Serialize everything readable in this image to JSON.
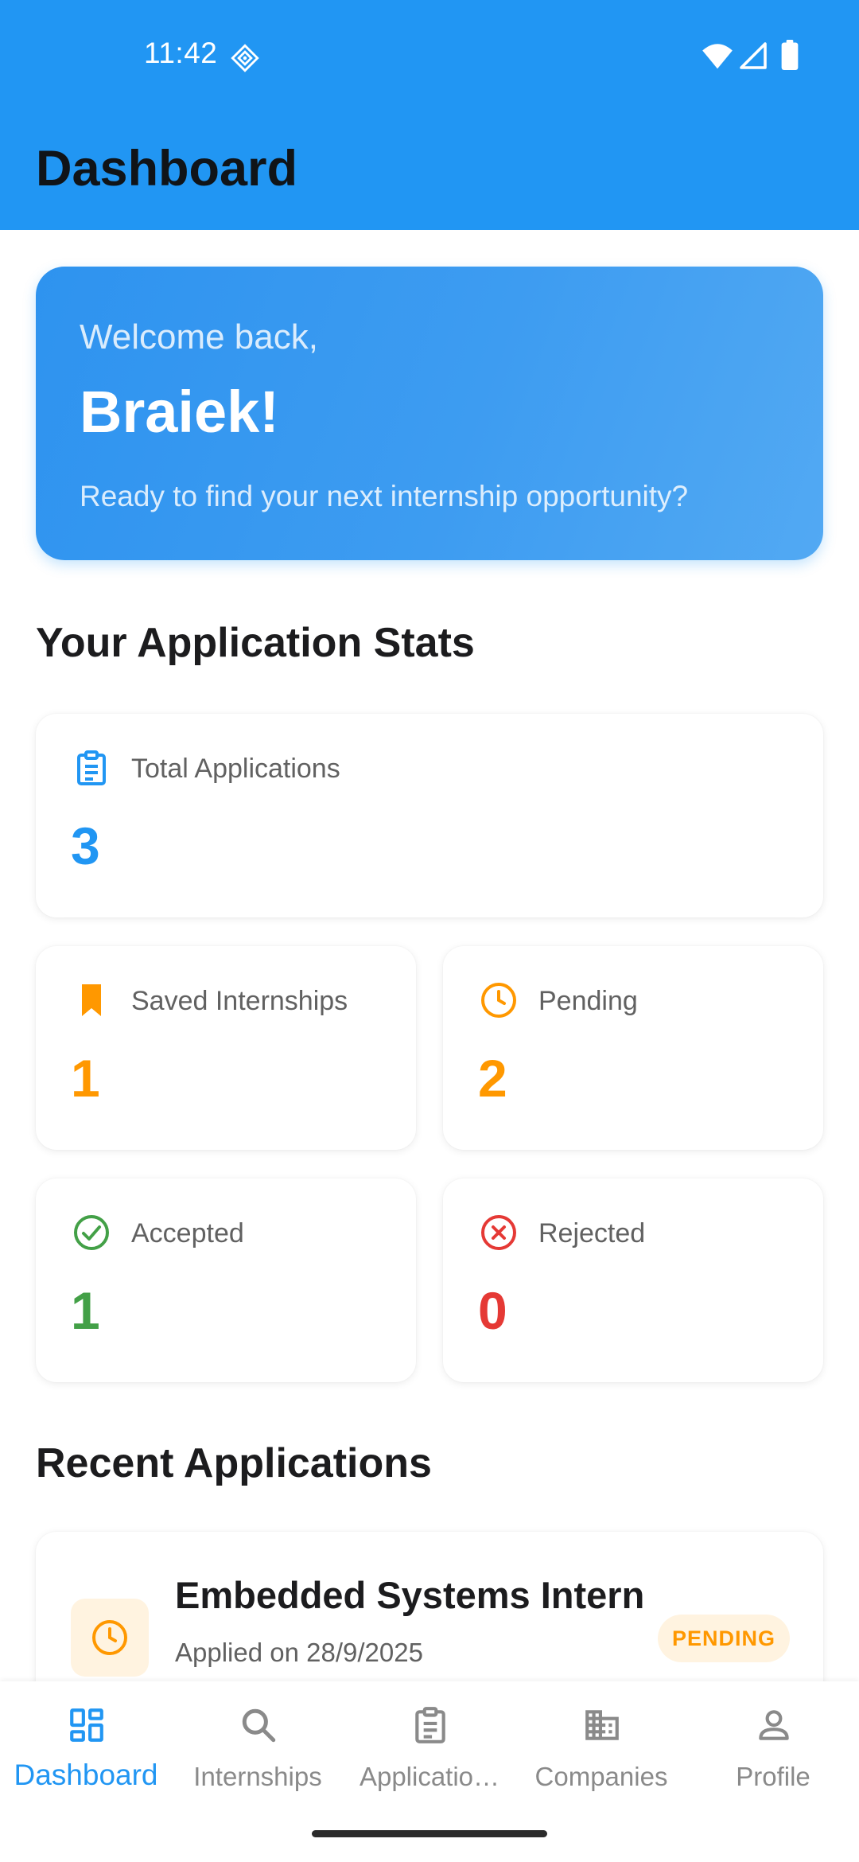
{
  "status_bar": {
    "time": "11:42"
  },
  "app_bar": {
    "title": "Dashboard"
  },
  "welcome": {
    "greeting": "Welcome back,",
    "name": "Braiek!",
    "subtitle": "Ready to find your next internship opportunity?"
  },
  "stats_section": {
    "title": "Your Application Stats"
  },
  "stats": [
    {
      "label": "Total Applications",
      "value": "3",
      "icon": "clipboard-icon",
      "color": "#2196f3"
    },
    {
      "label": "Saved Internships",
      "value": "1",
      "icon": "bookmark-icon",
      "color": "#ff9800"
    },
    {
      "label": "Pending",
      "value": "2",
      "icon": "clock-icon",
      "color": "#ff9800"
    },
    {
      "label": "Accepted",
      "value": "1",
      "icon": "check-circle-icon",
      "color": "#43a047"
    },
    {
      "label": "Rejected",
      "value": "0",
      "icon": "cancel-circle-icon",
      "color": "#e53935"
    }
  ],
  "recent_section": {
    "title": "Recent Applications"
  },
  "recent_applications": [
    {
      "title": "Embedded Systems Intern",
      "date": "Applied on 28/9/2025",
      "status": "PENDING",
      "icon": "clock-icon",
      "status_color": "#ff9800"
    }
  ],
  "bottom_nav": [
    {
      "label": "Dashboard",
      "icon": "dashboard-icon",
      "active": true
    },
    {
      "label": "Internships",
      "icon": "search-icon",
      "active": false
    },
    {
      "label": "Applicatio…",
      "icon": "clipboard-icon",
      "active": false
    },
    {
      "label": "Companies",
      "icon": "building-icon",
      "active": false
    },
    {
      "label": "Profile",
      "icon": "person-icon",
      "active": false
    }
  ],
  "colors": {
    "primary": "#2196f3",
    "pending": "#ff9800",
    "accepted": "#43a047",
    "rejected": "#e53935",
    "inactive_nav": "#8a8a8a"
  }
}
